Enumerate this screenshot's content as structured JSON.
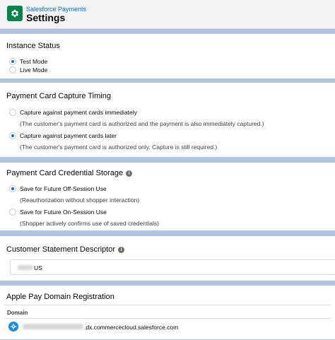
{
  "header": {
    "eyebrow": "Salesforce Payments",
    "title": "Settings",
    "icon": "settings-gear-icon",
    "icon_color": "#04844b"
  },
  "instance_status": {
    "title": "Instance Status",
    "options": [
      {
        "label": "Test Mode",
        "checked": true
      },
      {
        "label": "Live Mode",
        "checked": false
      }
    ]
  },
  "capture_timing": {
    "title": "Payment Card Capture Timing",
    "options": [
      {
        "label": "Capture against payment cards immediately",
        "help": "(The customer's payment card is authorized and the payment is also immediately captured.)",
        "checked": false
      },
      {
        "label": "Capture against payment cards later",
        "help": "(The customer's payment card is authorized only. Capture is still required.)",
        "checked": true
      }
    ]
  },
  "credential_storage": {
    "title": "Payment Card Credential Storage",
    "options": [
      {
        "label": "Save for Future Off-Session Use",
        "help": "(Reauthorization without shopper interaction)",
        "checked": true
      },
      {
        "label": "Save for Future On-Session Use",
        "help": "(Shopper actively confirms use of saved credentials)",
        "checked": false
      }
    ]
  },
  "statement_descriptor": {
    "title": "Customer Statement Descriptor",
    "value": "US"
  },
  "apple_pay": {
    "title": "Apple Pay Domain Registration",
    "column_header": "Domain",
    "domain_suffix": ".dx.commercecloud.salesforce.com"
  },
  "colors": {
    "accent": "#0070d2",
    "band": "#b0c4df",
    "header_bg": "#f3f3f3"
  }
}
